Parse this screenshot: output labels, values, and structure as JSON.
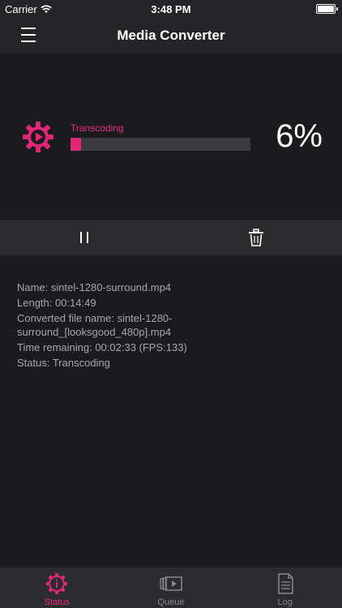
{
  "statusbar": {
    "carrier": "Carrier",
    "time": "3:48 PM"
  },
  "navbar": {
    "title": "Media Converter"
  },
  "progress": {
    "state": "Transcoding",
    "percent_text": "6%",
    "fraction": 0.06
  },
  "details": {
    "name": "Name: sintel-1280-surround.mp4",
    "length": "Length: 00:14:49",
    "converted_line1": "Converted file name: sintel-1280-",
    "converted_line2": "surround_[looksgood_480p].mp4",
    "time_remaining": "Time remaining: 00:02:33 (FPS:133)",
    "status": "Status: Transcoding"
  },
  "tabs": [
    {
      "label": "Status",
      "icon": "gear-icon",
      "active": true
    },
    {
      "label": "Queue",
      "icon": "queue-icon",
      "active": false
    },
    {
      "label": "Log",
      "icon": "log-icon",
      "active": false
    }
  ],
  "colors": {
    "accent": "#e02777",
    "background": "#1b1b1d"
  }
}
